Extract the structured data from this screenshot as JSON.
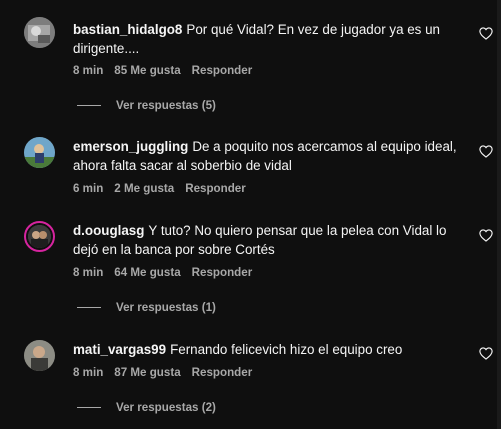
{
  "comments": [
    {
      "username": "bastian_hidalgo8",
      "text": "Por qué Vidal? En vez de jugador ya es un dirigente....",
      "time": "8 min",
      "likes": "85 Me gusta",
      "reply": "Responder",
      "view_replies": "Ver respuestas (5)"
    },
    {
      "username": "emerson_juggling",
      "text": "De a poquito nos acercamos al equipo ideal, ahora falta sacar al soberbio de vidal",
      "time": "6 min",
      "likes": "2 Me gusta",
      "reply": "Responder"
    },
    {
      "username": "d.oouglasg",
      "text": "Y tuto? No quiero pensar que la pelea con Vidal lo dejó en la banca por sobre Cortés",
      "time": "8 min",
      "likes": "64 Me gusta",
      "reply": "Responder",
      "view_replies": "Ver respuestas (1)"
    },
    {
      "username": "mati_vargas99",
      "text": "Fernando felicevich hizo el equipo creo",
      "time": "8 min",
      "likes": "87 Me gusta",
      "reply": "Responder",
      "view_replies": "Ver respuestas (2)"
    }
  ],
  "icons": {
    "like": "heart-outline-icon"
  },
  "colors": {
    "background": "#0f0f0f",
    "text": "#f5f5f5",
    "secondary": "#a8a8a8",
    "story_ring": "#d6249f"
  }
}
